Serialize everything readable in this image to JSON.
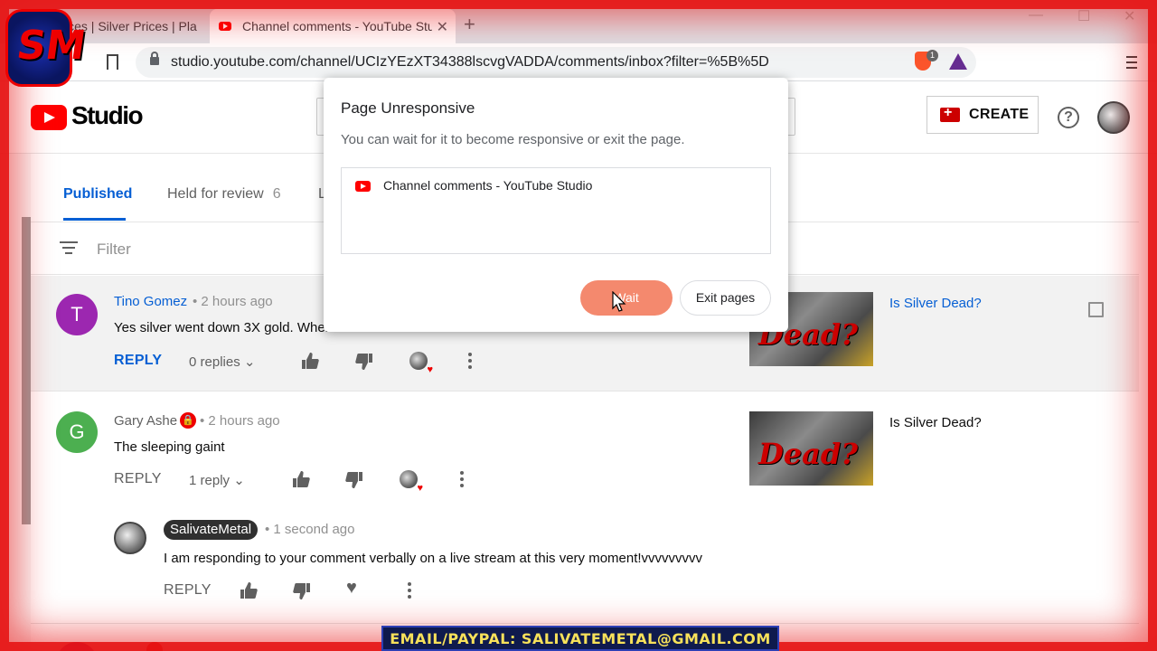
{
  "browser": {
    "tabs": [
      {
        "title": "Prices | Silver Prices | Pla"
      },
      {
        "title": "Channel comments - YouTube Studio"
      }
    ],
    "url": "studio.youtube.com/channel/UCIzYEzXT34388lscvgVADDA/comments/inbox?filter=%5B%5D",
    "brave_badge_count": "1"
  },
  "header": {
    "studio_label": "Studio",
    "create_label": "CREATE",
    "help_label": "?"
  },
  "tabs": {
    "published": "Published",
    "held": "Held for review",
    "held_count": "6",
    "third": "L"
  },
  "filter": {
    "placeholder": "Filter"
  },
  "comments": [
    {
      "avatar_letter": "T",
      "avatar_color": "#9c27b0",
      "author": "Tino Gomez",
      "time": "•  2 hours ago",
      "text": "Yes silver went down 3X gold. Wher",
      "reply_label": "REPLY",
      "replies": "0 replies",
      "video_title": "Is Silver Dead?",
      "thumb_text": "Dead?"
    },
    {
      "avatar_letter": "G",
      "avatar_color": "#4caf50",
      "author": "Gary Ashe",
      "time": "•  2 hours ago",
      "text": "The sleeping gaint",
      "reply_label": "REPLY",
      "replies": "1 reply",
      "video_title": "Is Silver Dead?",
      "thumb_text": "Dead?"
    }
  ],
  "reply": {
    "author": "SalivateMetal",
    "time": "•  1 second ago",
    "text": "I am responding to your comment verbally on a live stream at this very moment!vvvvvvvvv",
    "reply_label": "REPLY"
  },
  "dialog": {
    "title": "Page Unresponsive",
    "message": "You can wait for it to become responsive or exit the page.",
    "page_item": "Channel comments - YouTube Studio",
    "wait_label": "Wait",
    "exit_label": "Exit pages"
  },
  "overlay": {
    "logo_text": "SM",
    "banner": "EMAIL/PAYPAL: SALIVATEMETAL@GMAIL.COM"
  }
}
